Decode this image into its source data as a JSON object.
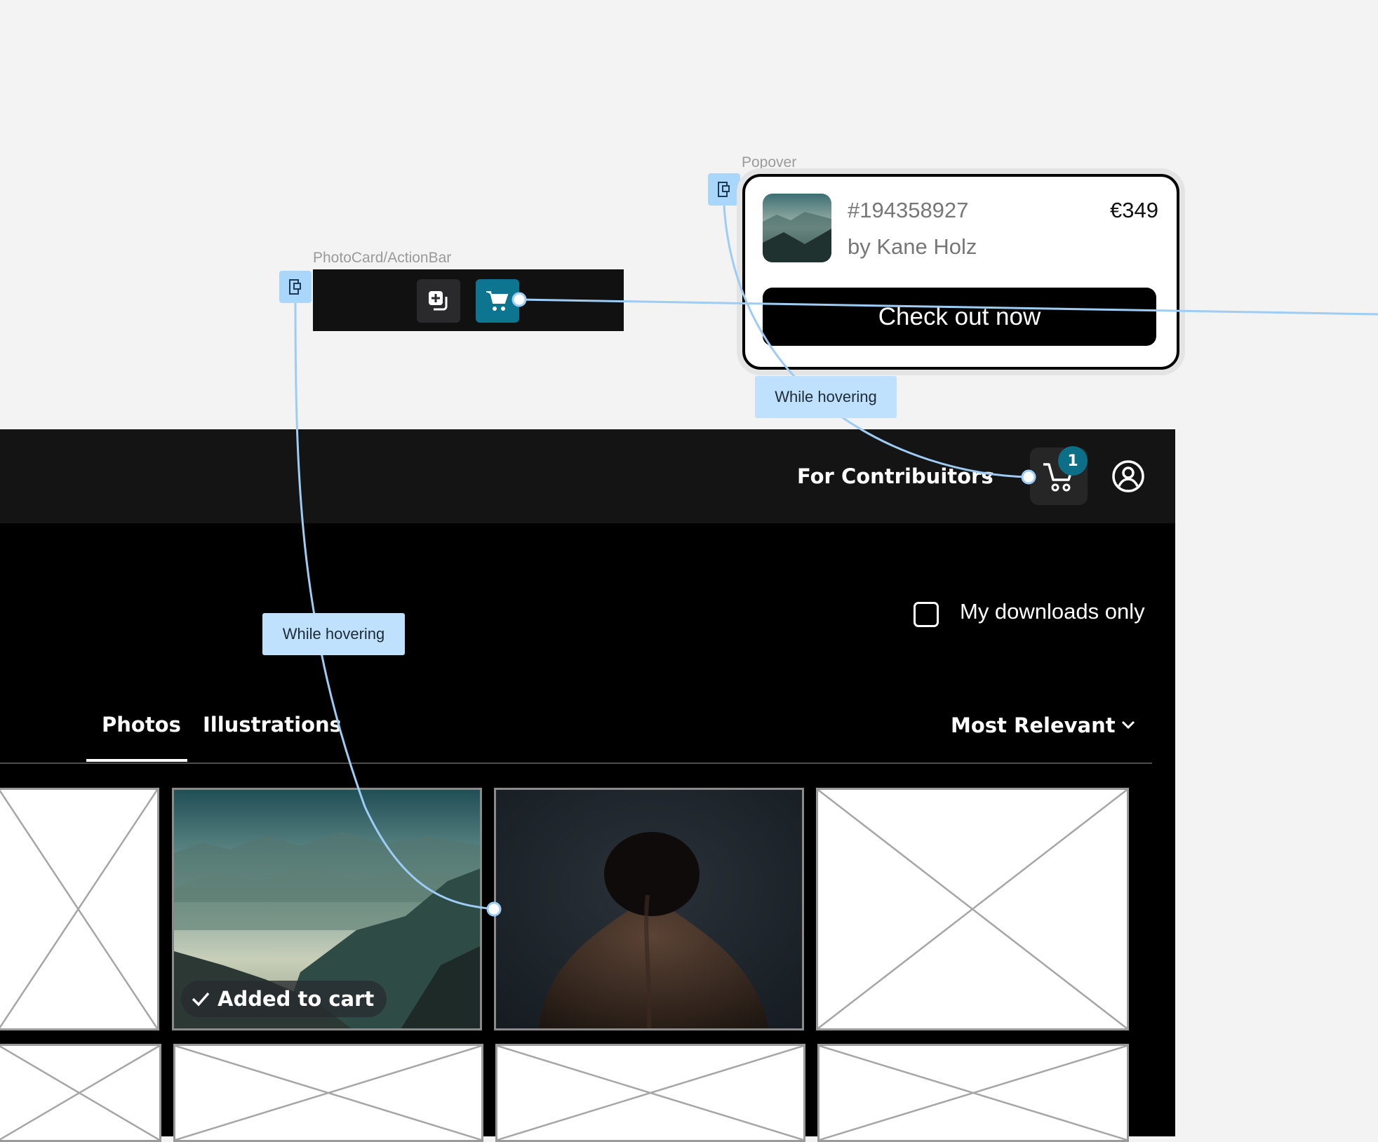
{
  "canvas": {
    "actionbar_frame_label": "PhotoCard/ActionBar",
    "popover_frame_label": "Popover",
    "interaction_labels": [
      "While hovering",
      "While hovering"
    ]
  },
  "popover": {
    "image_id": "#194358927",
    "author": "by Kane Holz",
    "price": "€349",
    "checkout_label": "Check out now"
  },
  "header": {
    "contributors_label": "For Contribuitors",
    "cart_count": "1"
  },
  "filters": {
    "downloads_only_label": "My downloads only",
    "downloads_only_checked": false
  },
  "tabs": [
    {
      "label": "Photos",
      "active": true
    },
    {
      "label": "Illustrations",
      "active": false
    }
  ],
  "sort": {
    "label": "Most Relevant"
  },
  "grid": {
    "added_to_cart_label": "Added to cart"
  },
  "colors": {
    "accent": "#0d7590",
    "prototype_link": "#a9d6fb"
  }
}
